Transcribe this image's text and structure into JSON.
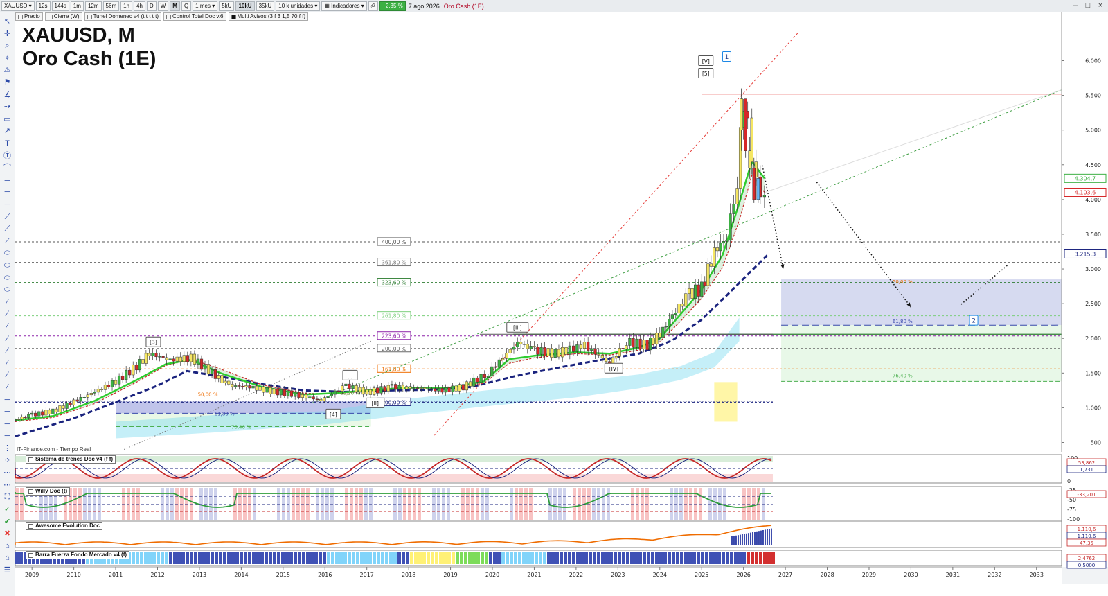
{
  "toolbar": {
    "symbol": "XAUUSD",
    "timeframes": [
      "12s",
      "144s",
      "1m",
      "12m",
      "56m",
      "1h",
      "4h",
      "D",
      "W",
      "M",
      "Q"
    ],
    "active_timeframe": "M",
    "period": "1 mes",
    "unit_buttons": [
      "5kU",
      "10kU",
      "35kU"
    ],
    "active_unit": "10kU",
    "units_select": "10 k unidades",
    "indicators_label": "Indicadores",
    "change_badge": "+2,35 %",
    "date": "7 ago 2026",
    "instrument_name": "Oro Cash (1E)"
  },
  "indicator_bar": [
    {
      "label": "Precio",
      "checked": false
    },
    {
      "label": "Cierre (W)",
      "checked": false
    },
    {
      "label": "Tunel Domenec v4 (t t t t t)",
      "checked": false
    },
    {
      "label": "Control Total Doc v.6",
      "checked": false
    },
    {
      "label": "Multi Avisos (3 f 3 1,5 70 f f)",
      "checked": true
    }
  ],
  "title": {
    "line1": "XAUUSD, M",
    "line2": "Oro Cash (1E)"
  },
  "source_label": "IT-Finance.com - Tiempo Real",
  "panels": [
    {
      "label": "Sistema de trenes Doc v4 (f f)",
      "ticks": [
        "100",
        "50",
        "0"
      ],
      "badges": [
        "53,862",
        "1,731"
      ]
    },
    {
      "label": "Willy Doc (t)",
      "ticks": [
        "-25",
        "-50",
        "-75",
        "-100"
      ],
      "badges": [
        "-33,201"
      ]
    },
    {
      "label": "Awesome Evolution Doc",
      "ticks": [],
      "badges": [
        "1.110,6",
        "1.110,6",
        "47,35"
      ]
    },
    {
      "label": "Barra Fuerza Fondo Mercado v4 (f)",
      "ticks": [],
      "badges": [
        "2,4762",
        "0,5000"
      ]
    }
  ],
  "colors": {
    "up": "#3cb043",
    "down": "#d62728",
    "green_line": "#2ecc2e",
    "navy": "#1a237e",
    "red_line": "#e53935",
    "blue_zone": "#c5cae9",
    "green_zone": "#e6f7e6",
    "cyan_band": "#7fdcef"
  },
  "chart_data": {
    "type": "line",
    "instrument": "XAUUSD",
    "y_ticks": [
      500,
      1000,
      1500,
      2000,
      2500,
      3000,
      3500,
      4000,
      4500,
      5000,
      5500,
      6000
    ],
    "y_tick_labels": [
      "500",
      "1.000",
      "1.500",
      "2.000",
      "2.500",
      "3.000",
      "3.500",
      "4.000",
      "4.500",
      "5.000",
      "5.500",
      "6.000"
    ],
    "x_tick_labels": [
      "2009",
      "2010",
      "2011",
      "2012",
      "2013",
      "2014",
      "2015",
      "2016",
      "2017",
      "2018",
      "2019",
      "2020",
      "2021",
      "2022",
      "2023",
      "2024",
      "2025",
      "2026",
      "2027",
      "2028",
      "2029",
      "2030",
      "2031",
      "2032",
      "2033"
    ],
    "price_labels": [
      {
        "text": "4.304,7",
        "value": 4304.7,
        "color": "#3cb043"
      },
      {
        "text": "4.103,6",
        "value": 4103.6,
        "color": "#d62728"
      },
      {
        "text": "3.215,3",
        "value": 3215.3,
        "color": "#1a237e"
      }
    ],
    "series": [
      {
        "style": "price",
        "x": [
          2008.6,
          2009.0,
          2009.5,
          2010.0,
          2010.5,
          2011.0,
          2011.5,
          2011.8,
          2012.3,
          2012.8,
          2013.3,
          2013.7,
          2014.2,
          2014.7,
          2015.2,
          2015.9,
          2016.5,
          2017.0,
          2017.6,
          2018.3,
          2018.8,
          2019.3,
          2019.9,
          2020.6,
          2021.0,
          2021.5,
          2022.2,
          2022.8,
          2023.2,
          2023.7,
          2024.0,
          2024.3,
          2024.7,
          2025.0,
          2025.3,
          2025.6,
          2025.85,
          2026.0,
          2026.2,
          2026.4,
          2026.6
        ],
        "y": [
          830,
          900,
          950,
          1090,
          1230,
          1380,
          1600,
          1780,
          1690,
          1720,
          1500,
          1320,
          1300,
          1240,
          1200,
          1110,
          1320,
          1220,
          1300,
          1280,
          1250,
          1300,
          1500,
          1950,
          1830,
          1780,
          1900,
          1640,
          1950,
          1900,
          2060,
          2330,
          2640,
          2720,
          3250,
          3450,
          4300,
          5450,
          4600,
          3980,
          4304.7
        ]
      },
      {
        "style": "green",
        "x": [
          2008.6,
          2009.5,
          2010.5,
          2011.5,
          2012.2,
          2012.8,
          2013.5,
          2014.5,
          2015.5,
          2016.2,
          2017.0,
          2018.0,
          2019.0,
          2019.8,
          2020.4,
          2021.0,
          2022.0,
          2022.8,
          2023.5,
          2024.0,
          2024.5,
          2025.0,
          2025.5,
          2025.9,
          2026.2,
          2026.5
        ],
        "y": [
          820,
          880,
          1100,
          1400,
          1630,
          1690,
          1500,
          1300,
          1190,
          1210,
          1250,
          1290,
          1290,
          1380,
          1700,
          1750,
          1800,
          1780,
          1870,
          2000,
          2350,
          2700,
          3200,
          3950,
          4550,
          4304.7
        ]
      },
      {
        "style": "red",
        "x": [
          2008.6,
          2009.5,
          2010.5,
          2011.5,
          2012.2,
          2012.8,
          2013.5,
          2014.5,
          2015.5,
          2016.2,
          2017.0,
          2018.0,
          2019.0,
          2019.8,
          2020.4,
          2021.0,
          2022.0,
          2022.8,
          2023.5,
          2024.0,
          2024.5,
          2025.0,
          2025.5,
          2025.9,
          2026.2,
          2026.5
        ],
        "y": [
          800,
          860,
          1060,
          1370,
          1610,
          1700,
          1560,
          1330,
          1210,
          1200,
          1240,
          1285,
          1300,
          1350,
          1640,
          1720,
          1780,
          1760,
          1830,
          1950,
          2250,
          2580,
          3020,
          3700,
          4350,
          4103.6
        ]
      },
      {
        "style": "navy",
        "x": [
          2008.6,
          2010.0,
          2011.0,
          2012.0,
          2012.7,
          2013.5,
          2014.5,
          2015.5,
          2016.5,
          2017.5,
          2018.5,
          2019.5,
          2020.5,
          2021.5,
          2022.5,
          2023.5,
          2024.3,
          2025.0,
          2025.6,
          2026.2,
          2026.6
        ],
        "y": [
          590,
          850,
          1080,
          1320,
          1530,
          1450,
          1340,
          1250,
          1230,
          1250,
          1260,
          1300,
          1450,
          1570,
          1680,
          1780,
          1970,
          2270,
          2620,
          2980,
          3215.3
        ]
      }
    ],
    "fibonacci_levels": [
      {
        "label": "400,00 %",
        "value": 3390
      },
      {
        "label": "361,80 %",
        "value": 3095
      },
      {
        "label": "323,60 %",
        "value": 2805
      },
      {
        "label": "261,80 %",
        "value": 2325
      },
      {
        "label": "223,60 %",
        "value": 2035
      },
      {
        "label": "200,00 %",
        "value": 1855
      },
      {
        "label": "161,80 %",
        "value": 1560
      },
      {
        "label": "100,00 %",
        "value": 1080
      },
      {
        "label": "88,20 %",
        "value": 1220
      },
      {
        "label": "76,40 %",
        "value": 730
      },
      {
        "label": "61,80 %",
        "value": 920
      },
      {
        "label": "50,00 %",
        "value": 1200
      }
    ],
    "target_zone": {
      "label_top": "50,00 %",
      "label_mid": "61,80 %",
      "label_low": "76,40 %",
      "top": 2850,
      "mid": 2190,
      "bottom": 1380
    },
    "horizontal_lines": [
      {
        "value": 5520,
        "color": "#e53935"
      },
      {
        "value": 2060,
        "color": "#2e7d32"
      }
    ],
    "wave_labels": [
      {
        "text": "[3]",
        "x": 2011.9,
        "y": 1950
      },
      {
        "text": "[4]",
        "x": 2016.2,
        "y": 910
      },
      {
        "text": "[I]",
        "x": 2016.6,
        "y": 1470
      },
      {
        "text": "[II]",
        "x": 2017.2,
        "y": 1070
      },
      {
        "text": "[III]",
        "x": 2020.6,
        "y": 2160
      },
      {
        "text": "[IV]",
        "x": 2022.9,
        "y": 1570
      },
      {
        "text": "[5]",
        "x": 2025.1,
        "y": 5820
      },
      {
        "text": "[V]",
        "x": 2025.1,
        "y": 6000
      },
      {
        "text": "1",
        "x": 2025.6,
        "y": 6060
      },
      {
        "text": "2",
        "x": 2031.5,
        "y": 2260
      }
    ]
  }
}
